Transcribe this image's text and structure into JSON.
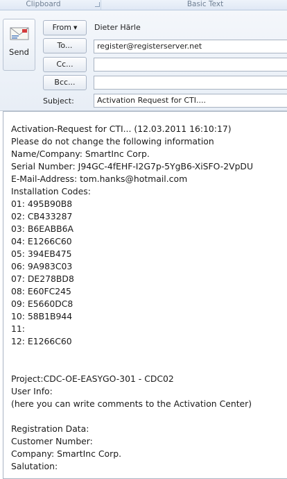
{
  "ribbon": {
    "groups": [
      "Clipboard",
      "Basic Text"
    ]
  },
  "send_button": {
    "label": "Send",
    "icon": "send-envelope-icon"
  },
  "from": {
    "button_label": "From",
    "value": "Dieter Härle"
  },
  "to": {
    "button_label": "To...",
    "value": "register@registerserver.net"
  },
  "cc": {
    "button_label": "Cc...",
    "value": ""
  },
  "bcc": {
    "button_label": "Bcc...",
    "value": ""
  },
  "subject": {
    "label": "Subject:",
    "value": "Activation Request for CTI...."
  },
  "body_lines": [
    "Activation-Request for CTI... (12.03.2011 16:10:17)",
    "Please do not change the following information",
    "Name/Company: SmartInc Corp.",
    "Serial Number: J94GC-4fEHF-I2G7p-5YgB6-XiSFO-2VpDU",
    "E-Mail-Address: tom.hanks@hotmail.com",
    "Installation Codes:",
    "01: 495B90B8",
    "02: CB433287",
    "03: B6EABB6A",
    "04: E1266C60",
    "05: 394EB475",
    "06: 9A983C03",
    "07: DE278BD8",
    "08: E60FC245",
    "09: E5660DC8",
    "10: 58B1B944",
    "11:",
    "12: E1266C60",
    "",
    "",
    "Project:CDC-OE-EASYGO-301 - CDC02",
    "User Info:",
    "(here you can write comments to the Activation Center)",
    "",
    "Registration Data:",
    "Customer Number:",
    "Company: SmartInc Corp.",
    "Salutation:"
  ]
}
